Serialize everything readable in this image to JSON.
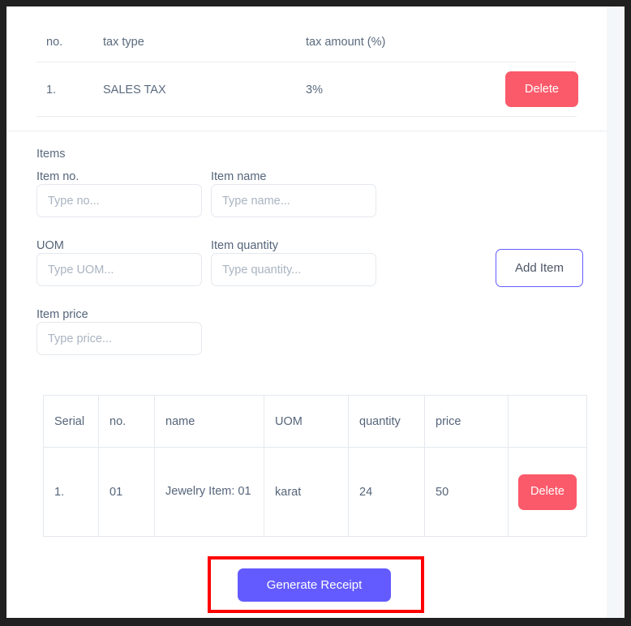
{
  "tax_table": {
    "columns": [
      "no.",
      "tax type",
      "tax amount (%)"
    ],
    "rows": [
      {
        "no": "1.",
        "tax_type": "SALES TAX",
        "tax_amount": "3%",
        "delete_label": "Delete"
      }
    ]
  },
  "items_form": {
    "heading": "Items",
    "fields": {
      "item_no": {
        "label": "Item no.",
        "value": "",
        "placeholder": "Type no..."
      },
      "item_name": {
        "label": "Item name",
        "value": "",
        "placeholder": "Type name..."
      },
      "uom": {
        "label": "UOM",
        "value": "",
        "placeholder": "Type UOM..."
      },
      "item_qty": {
        "label": "Item quantity",
        "value": "",
        "placeholder": "Type quantity..."
      },
      "item_price": {
        "label": "Item price",
        "value": "",
        "placeholder": "Type price..."
      }
    },
    "add_item_label": "Add Item"
  },
  "items_table": {
    "columns": [
      "Serial",
      "no.",
      "name",
      "UOM",
      "quantity",
      "price",
      ""
    ],
    "rows": [
      {
        "serial": "1.",
        "no": "01",
        "name": "Jewelry Item: 01",
        "uom": "karat",
        "quantity": "24",
        "price": "50",
        "delete_label": "Delete"
      }
    ]
  },
  "footer": {
    "generate_receipt_label": "Generate Receipt"
  },
  "colors": {
    "primary": "#635bff",
    "danger": "#fa5a6a",
    "annotation": "#ff0000",
    "border": "#e4e8ed",
    "text": "#55657a",
    "page_background": "#f4f7fa",
    "frame": "#202020"
  }
}
